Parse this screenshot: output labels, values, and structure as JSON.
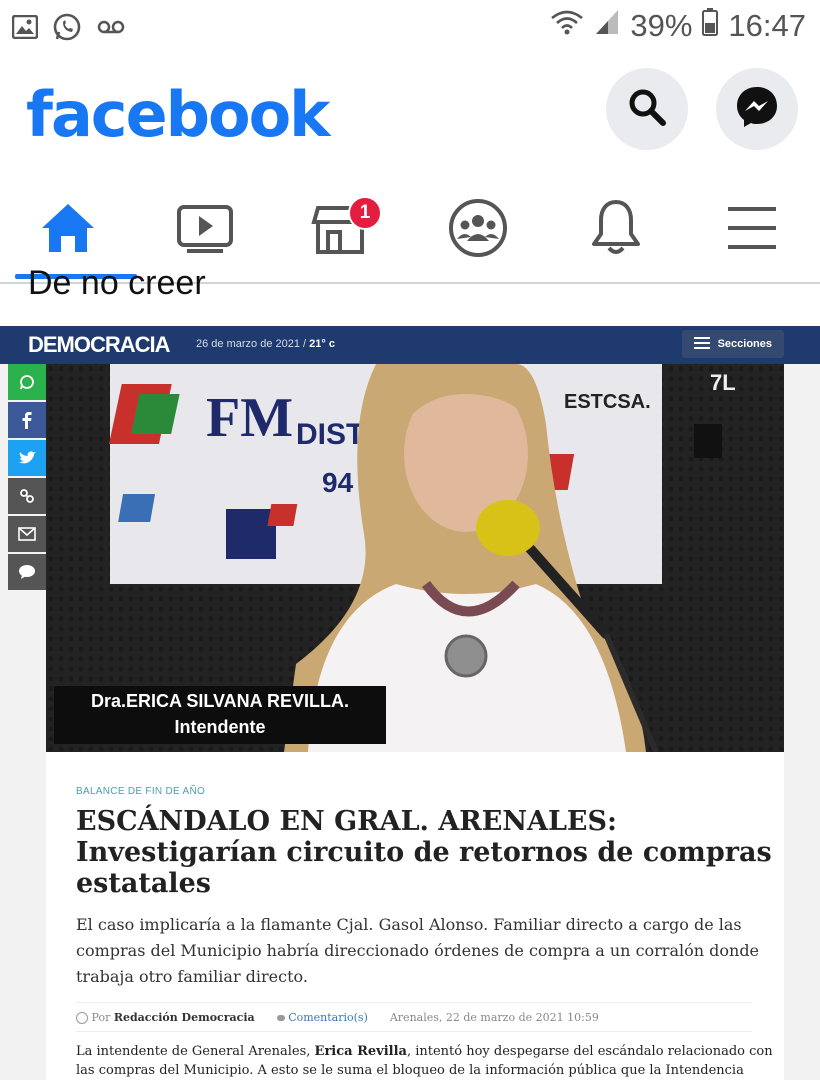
{
  "status_bar": {
    "icons_left": [
      "image-icon",
      "whatsapp-icon",
      "voicemail-icon"
    ],
    "battery": "39%",
    "time": "16:47"
  },
  "facebook": {
    "logo": "facebook",
    "brand_color": "#1877f2",
    "nav": [
      {
        "name": "home",
        "active": true
      },
      {
        "name": "watch",
        "active": false
      },
      {
        "name": "marketplace",
        "badge": "1"
      },
      {
        "name": "groups",
        "active": false
      },
      {
        "name": "notifications",
        "active": false
      },
      {
        "name": "menu",
        "active": false
      }
    ]
  },
  "post": {
    "title": "De no creer"
  },
  "news_site": {
    "logo": "DEMOCRACIA",
    "date": "26 de marzo de 2021 / ",
    "temperature": "21° c",
    "sections_label": "Secciones",
    "bar_color": "#1f3a6e",
    "caption_line1": "Dra.ERICA SILVANA REVILLA.",
    "caption_line2": "Intendente",
    "kicker": "BALANCE DE FIN DE AÑO",
    "headline": "ESCÁNDALO EN GRAL. ARENALES: Investigarían circuito de retornos de compras estatales",
    "lede": "El caso implicaría a la flamante Cjal. Gasol Alonso. Familiar directo a cargo de las compras del Municipio habría direccionado órdenes de compra a un corralón donde trabaja otro familiar directo.",
    "meta": {
      "by_prefix": "Por",
      "author": "Redacción Democracia",
      "comments": "Comentario(s)",
      "dateline": "Arenales, 22 de marzo de 2021 10:59"
    },
    "body_start": "La intendente de General Arenales, ",
    "body_bold": "Erica Revilla",
    "body_rest": ", intentó hoy despegarse del escándalo relacionado con las compras del Municipio. A esto se le suma el bloqueo de la información pública que la Intendencia"
  },
  "photo_banner": {
    "fm_text": "FM",
    "distr_text": "DISTRI",
    "freq_text": "94",
    "estcsa": "ESTCSA.",
    "channel": "7L"
  }
}
